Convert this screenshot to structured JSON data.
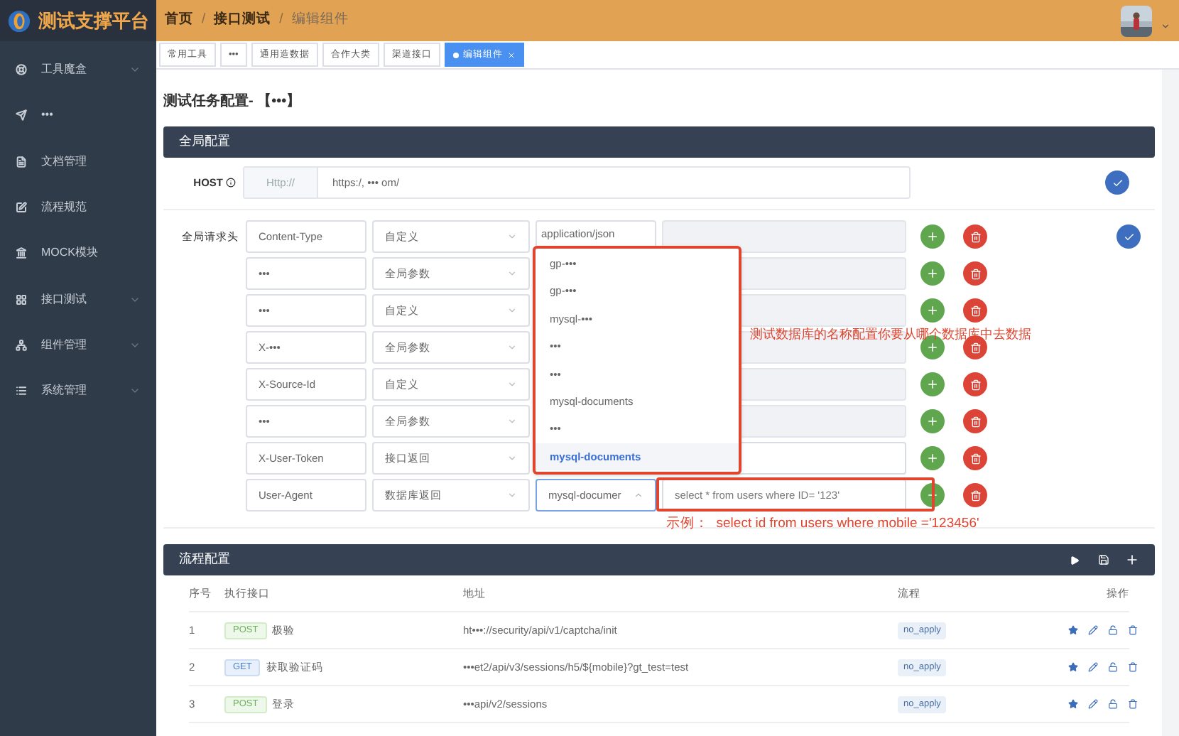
{
  "app": {
    "title": "测试支撑平台"
  },
  "breadcrumb": [
    {
      "label": "首页",
      "current": false
    },
    {
      "separator": "/",
      "label": "接口测试",
      "current": false
    },
    {
      "separator": "/",
      "label": "编辑组件",
      "current": true
    }
  ],
  "sidebar": {
    "items": [
      {
        "label": "工具魔盒",
        "expandable": true
      },
      {
        "label": "•••",
        "expandable": false
      },
      {
        "label": "文档管理",
        "expandable": false
      },
      {
        "label": "流程规范",
        "expandable": false
      },
      {
        "label": "MOCK模块",
        "expandable": false
      },
      {
        "label": "接口测试",
        "expandable": true
      },
      {
        "label": "组件管理",
        "expandable": true
      },
      {
        "label": "系统管理",
        "expandable": true
      }
    ]
  },
  "tabs": [
    {
      "label": "常用工具",
      "selected": false,
      "closable": false
    },
    {
      "label": "•••",
      "selected": false,
      "closable": false
    },
    {
      "label": "通用造数据",
      "selected": false,
      "closable": false
    },
    {
      "label": "合作大类",
      "selected": false,
      "closable": false
    },
    {
      "label": "渠道接口",
      "selected": false,
      "closable": false
    },
    {
      "label": "编辑组件",
      "selected": true,
      "closable": true
    }
  ],
  "page_title": "测试任务配置- 【•••】",
  "global_config": {
    "title": "全局配置",
    "host": {
      "label": "HOST",
      "prefix": "Http://",
      "value": "https:/, ••• om/"
    },
    "headers_label": "全局请求头",
    "headers": [
      {
        "name": "Content-Type",
        "source": "自定义",
        "kind": "input",
        "value": "application/json",
        "field_disabled": true
      },
      {
        "name": "•••",
        "source": "全局参数",
        "kind": "covered",
        "field_disabled": true
      },
      {
        "name": "•••",
        "source": "自定义",
        "kind": "covered",
        "field_disabled": true
      },
      {
        "name": "X-•••",
        "source": "全局参数",
        "kind": "covered",
        "field_disabled": true
      },
      {
        "name": "X-Source-Id",
        "source": "自定义",
        "kind": "covered",
        "field_disabled": true
      },
      {
        "name": "•••",
        "source": "全局参数",
        "kind": "input",
        "field_disabled": true
      },
      {
        "name": "X-User-Token",
        "source": "接口返回",
        "kind": "input",
        "field_disabled": false
      },
      {
        "name": "User-Agent",
        "source": "数据库返回",
        "kind": "db-select",
        "value": "mysql-documer",
        "field_placeholder": "select * from users where ID= '123'",
        "field_disabled": false
      }
    ],
    "db_options": [
      {
        "label": "gp-•••",
        "selected": false
      },
      {
        "label": "gp-•••",
        "selected": false
      },
      {
        "label": "mysql-•••",
        "selected": false
      },
      {
        "label": "•••",
        "selected": false
      },
      {
        "label": "•••",
        "selected": false
      },
      {
        "label": "mysql-documents",
        "selected": false
      },
      {
        "label": "•••",
        "selected": false
      },
      {
        "label": "mysql-documents",
        "selected": true
      }
    ],
    "annotation": "测试数据库的名称配置你要从哪个数据库中去数据",
    "example": "示例：  select id from users where mobile ='123456'"
  },
  "flow_config": {
    "title": "流程配置",
    "columns": [
      "序号",
      "执行接口",
      "地址",
      "流程",
      "操作"
    ],
    "rows": [
      {
        "index": "1",
        "method": "POST",
        "kind": "post",
        "name": "极验",
        "url": "ht•••://security/api/v1/captcha/init",
        "flow": "no_apply"
      },
      {
        "index": "2",
        "method": "GET",
        "kind": "get",
        "name": "获取验证码",
        "url": "•••et2/api/v3/sessions/h5/${mobile}?gt_test=test",
        "flow": "no_apply"
      },
      {
        "index": "3",
        "method": "POST",
        "kind": "post",
        "name": "登录",
        "url": "•••api/v2/sessions",
        "flow": "no_apply"
      }
    ]
  }
}
